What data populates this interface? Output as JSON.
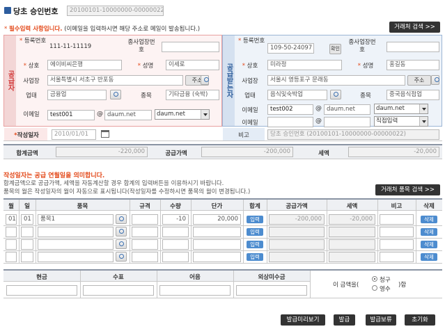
{
  "title": {
    "label": "당초 승인번호",
    "value": "20100101-10000000-00000022"
  },
  "notice": {
    "required": "필수입력 사항입니다.",
    "email_note": "(이메일을 입력하시면 해당 주소로 메일이 발송됩니다.)"
  },
  "buttons": {
    "partner_search": "거래처 검색 >>",
    "item_search": "거래처 품목 검색 >>",
    "address": "주소",
    "confirm": "확인",
    "preview": "발급미리보기",
    "issue": "발급",
    "hold": "발급보류",
    "reset": "초기화"
  },
  "supplier": {
    "side_label": "공급자",
    "reg_no_label": "등록번호",
    "reg_no": "111-11-11119",
    "sub_biz_label": "종사업장번호",
    "name_label": "상호",
    "name": "에이비씨은행",
    "ceo_label": "성명",
    "ceo": "이세로",
    "address_label": "사업장",
    "address": "서울특별시 서초구 반포동",
    "type_label": "업태",
    "type": "금융업",
    "item_label": "종목",
    "item": "기타금융 (숙박)",
    "email_label": "이메일",
    "email_id": "test001",
    "email_at": "@",
    "email_domain": "daum.net",
    "email_select": "daum.net"
  },
  "receiver": {
    "side_label": "공급받는자",
    "reg_no_label": "등록번호",
    "reg_no": "109-50-24097",
    "sub_biz_label": "종사업장번호",
    "name_label": "상호",
    "name": "미라정",
    "ceo_label": "성명",
    "ceo": "홍길동",
    "address_label": "사업장",
    "address": "서울시 영등포구 문래동",
    "type_label": "업태",
    "type": "음식및숙박업",
    "item_label": "종목",
    "item": "중국음식점업",
    "email1_label": "이메일",
    "email1_id": "test002",
    "email1_at": "@",
    "email1_domain": "daum.net",
    "email1_select": "daum.net",
    "email2_label": "이메일",
    "email2_at": "@",
    "email2_select": "직접입력"
  },
  "date_row": {
    "label": "작성일자",
    "value": "2010/01/01",
    "note_label": "비고",
    "note_value": "당초 승인번호 (20100101-10000000-00000022)"
  },
  "totals": {
    "total_label": "합계금액",
    "total": "-220,000",
    "supply_label": "공급가액",
    "supply": "-200,000",
    "tax_label": "세액",
    "tax": "-20,000"
  },
  "info": {
    "line1": "작성일자는 공급 연월일을 의미합니다.",
    "line2": "합계금액으로 공급가액, 세액을 자동계산할 경우 합계의 입력버튼을 이용하시기 바랍니다.",
    "line3": "품목의 월은 작성일자의 월이 자동으로 표시됩니다(작성일자를 수정하시면 품목의 월이 변경됩니다.)"
  },
  "items_table": {
    "headers": [
      "월",
      "일",
      "품목",
      "규격",
      "수량",
      "단가",
      "합계",
      "공급가액",
      "세액",
      "비고",
      "삭제"
    ],
    "rows": [
      {
        "month": "01",
        "day": "01",
        "name": "품목1",
        "spec": "",
        "qty": "-10",
        "price": "20,000",
        "calc": "입력",
        "supply": "-200,000",
        "tax": "-20,000",
        "note": "",
        "del": "삭제"
      },
      {
        "month": "",
        "day": "",
        "name": "",
        "spec": "",
        "qty": "",
        "price": "",
        "calc": "입력",
        "supply": "",
        "tax": "",
        "note": "",
        "del": "삭제"
      },
      {
        "month": "",
        "day": "",
        "name": "",
        "spec": "",
        "qty": "",
        "price": "",
        "calc": "입력",
        "supply": "",
        "tax": "",
        "note": "",
        "del": "삭제"
      },
      {
        "month": "",
        "day": "",
        "name": "",
        "spec": "",
        "qty": "",
        "price": "",
        "calc": "입력",
        "supply": "",
        "tax": "",
        "note": "",
        "del": "삭제"
      }
    ]
  },
  "payment": {
    "headers": [
      "현금",
      "수표",
      "어음",
      "외상미수금"
    ],
    "prefix": "이 금액을(",
    "claim": "청구",
    "receipt": "영수",
    "suffix": ")함"
  }
}
